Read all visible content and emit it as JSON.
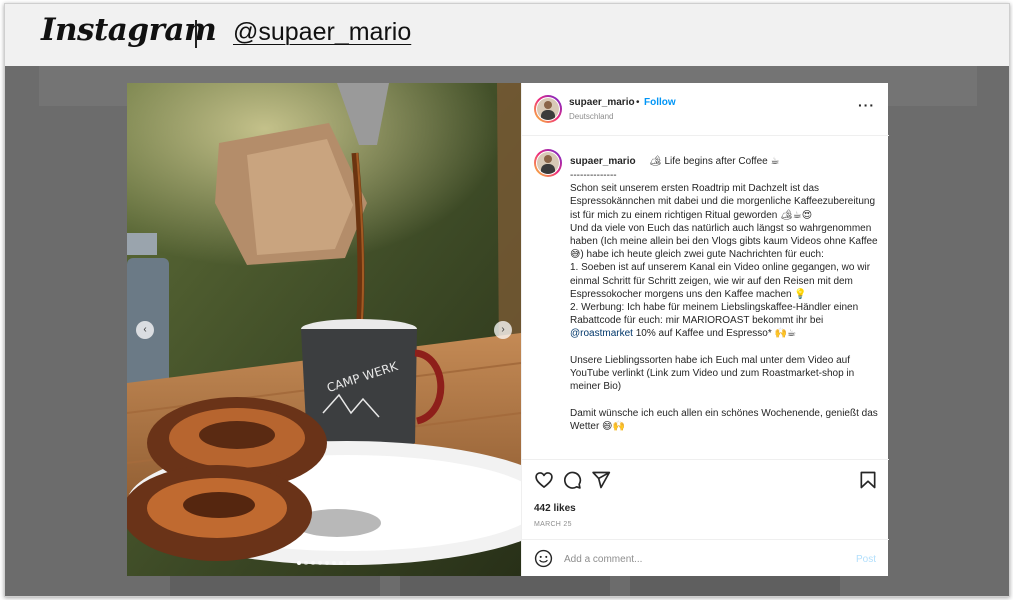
{
  "banner": {
    "logo_text": "Instagram",
    "handle": "@supaer_mario"
  },
  "post": {
    "header": {
      "username": "supaer_mario",
      "bullet": "•",
      "follow_label": "Follow",
      "location": "Deutschland",
      "more_label": "···"
    },
    "caption": {
      "username": "supaer_mario",
      "first_line": "🏕 Life begins after Coffee ☕",
      "body_part1": "--------------\nSchon seit unserem ersten Roadtrip mit Dachzelt ist das Espressokännchen mit dabei und die morgenliche Kaffeezubereitung ist für mich zu einem richtigen Ritual geworden 🏕☕😍\nUnd da viele von Euch das natürlich auch längst so wahrgenommen haben (Ich meine allein bei den Vlogs gibts kaum Videos ohne Kaffee 😅) habe ich heute gleich zwei gute Nachrichten für euch:\n1. Soeben ist auf unserem Kanal ein Video online gegangen, wo wir einmal Schritt für Schritt zeigen, wie wir auf den Reisen mit dem Espressokocher morgens uns den Kaffee machen 💡\n2. Werbung: Ich habe für meinem Liebslingskaffee-Händler einen Rabattcode für euch: mir MARIOROAST bekommt ihr bei ",
      "mention": "@roastmarket",
      "body_part2": " 10% auf Kaffee und Espresso* 🙌☕\n\nUnsere Lieblingssorten habe ich Euch mal unter dem Video auf YouTube verlinkt (Link zum Video und zum Roastmarket-shop in meiner Bio)\n\nDamit wünsche ich euch allen ein schönes Wochenende, genießt das Wetter 😄🙌"
    },
    "likes": "442 likes",
    "date": "MARCH 25",
    "comment_placeholder": "Add a comment...",
    "post_label": "Post",
    "carousel": {
      "prev": "‹",
      "next": "›",
      "total_slides": 8,
      "active_slide": 1
    }
  },
  "icons": [
    "heart-icon",
    "comment-icon",
    "share-icon",
    "bookmark-icon",
    "emoji-icon",
    "chevron-left-icon",
    "chevron-right-icon"
  ],
  "colors": {
    "follow": "#0095f6",
    "post_disabled": "#b2dffc",
    "mention": "#00376b",
    "overlay": "#6c6c6c"
  }
}
